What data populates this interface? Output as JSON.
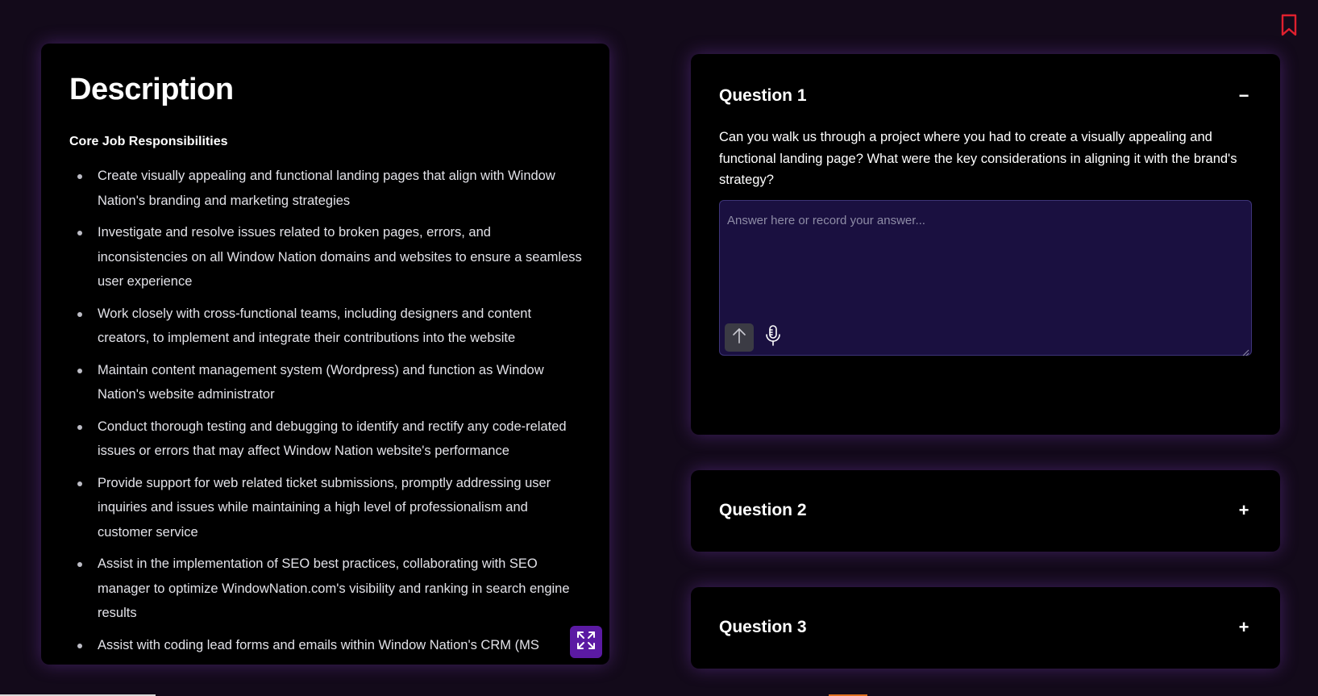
{
  "description": {
    "title": "Description",
    "subtitle": "Core Job Responsibilities",
    "items": [
      "Create visually appealing and functional landing pages that align with Window Nation's branding and marketing strategies",
      "Investigate and resolve issues related to broken pages, errors, and inconsistencies on all Window Nation domains and websites to ensure a seamless user experience",
      "Work closely with cross-functional teams, including designers and content creators, to implement and integrate their contributions into the website",
      "Maintain content management system (Wordpress) and function as Window Nation's website administrator",
      "Conduct thorough testing and debugging to identify and rectify any code-related issues or errors that may affect Window Nation website's performance",
      "Provide support for web related ticket submissions, promptly addressing user inquiries and issues while maintaining a high level of professionalism and customer service",
      "Assist in the implementation of SEO best practices, collaborating with SEO manager to optimize WindowNation.com's visibility and ranking in search engine results",
      "Assist with coding lead forms and emails within Window Nation's CRM (MS"
    ],
    "expand_icon": "expand-icon"
  },
  "questions": [
    {
      "title": "Question 1",
      "toggle": "−",
      "text": "Can you walk us through a project where you had to create a visually appealing and functional landing page? What were the key considerations in aligning it with the brand's strategy?",
      "answer_value": "",
      "answer_placeholder": "Answer here or record your answer..."
    },
    {
      "title": "Question 2",
      "toggle": "+"
    },
    {
      "title": "Question 3",
      "toggle": "+"
    }
  ],
  "icons": {
    "bookmark": "bookmark-icon",
    "send": "arrow-up-icon",
    "mic": "microphone-icon",
    "expand": "expand-icon"
  },
  "colors": {
    "background": "#130a1a",
    "panel": "#000000",
    "accent": "#5b1aa3",
    "answer_bg": "#1a1040",
    "bookmark": "#e0202e"
  }
}
